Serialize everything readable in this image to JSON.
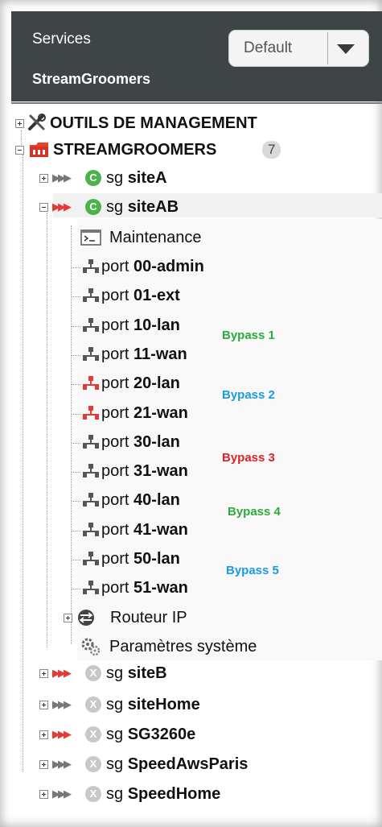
{
  "header": {
    "services_label": "Services",
    "dropdown_value": "Default",
    "title": "StreamGroomers"
  },
  "tree": {
    "tools": "OUTILS DE MANAGEMENT",
    "root": "STREAMGROOMERS",
    "root_count": "7",
    "sites": [
      {
        "prefix": "sg",
        "name": "siteA",
        "badge": "C"
      },
      {
        "prefix": "sg",
        "name": "siteAB",
        "badge": "C"
      },
      {
        "prefix": "sg",
        "name": "siteB",
        "badge": "X"
      },
      {
        "prefix": "sg",
        "name": "siteHome",
        "badge": "X"
      },
      {
        "prefix": "sg",
        "name": "SG3260e",
        "badge": "X"
      },
      {
        "prefix": "sg",
        "name": "SpeedAwsParis",
        "badge": "X"
      },
      {
        "prefix": "sg",
        "name": "SpeedHome",
        "badge": "X"
      }
    ],
    "maintenance": "Maintenance",
    "ports": [
      {
        "prefix": "port",
        "name": "00-admin",
        "red": false
      },
      {
        "prefix": "port",
        "name": "01-ext",
        "red": false
      },
      {
        "prefix": "port",
        "name": "10-lan",
        "red": false
      },
      {
        "prefix": "port",
        "name": "11-wan",
        "red": false
      },
      {
        "prefix": "port",
        "name": "20-lan",
        "red": true
      },
      {
        "prefix": "port",
        "name": "21-wan",
        "red": true
      },
      {
        "prefix": "port",
        "name": "30-lan",
        "red": false
      },
      {
        "prefix": "port",
        "name": "31-wan",
        "red": false
      },
      {
        "prefix": "port",
        "name": "40-lan",
        "red": false
      },
      {
        "prefix": "port",
        "name": "41-wan",
        "red": false
      },
      {
        "prefix": "port",
        "name": "50-lan",
        "red": false
      },
      {
        "prefix": "port",
        "name": "51-wan",
        "red": false
      }
    ],
    "router": "Routeur IP",
    "system_params": "Paramètres système"
  },
  "annotations": [
    {
      "text": "Bypass 1",
      "color": "#2eaa3f"
    },
    {
      "text": "Bypass 2",
      "color": "#1a9ae0"
    },
    {
      "text": "Bypass 3",
      "color": "#e0202a"
    },
    {
      "text": "Bypass 4",
      "color": "#2eaa3f"
    },
    {
      "text": "Bypass 5",
      "color": "#1a9ae0"
    }
  ]
}
